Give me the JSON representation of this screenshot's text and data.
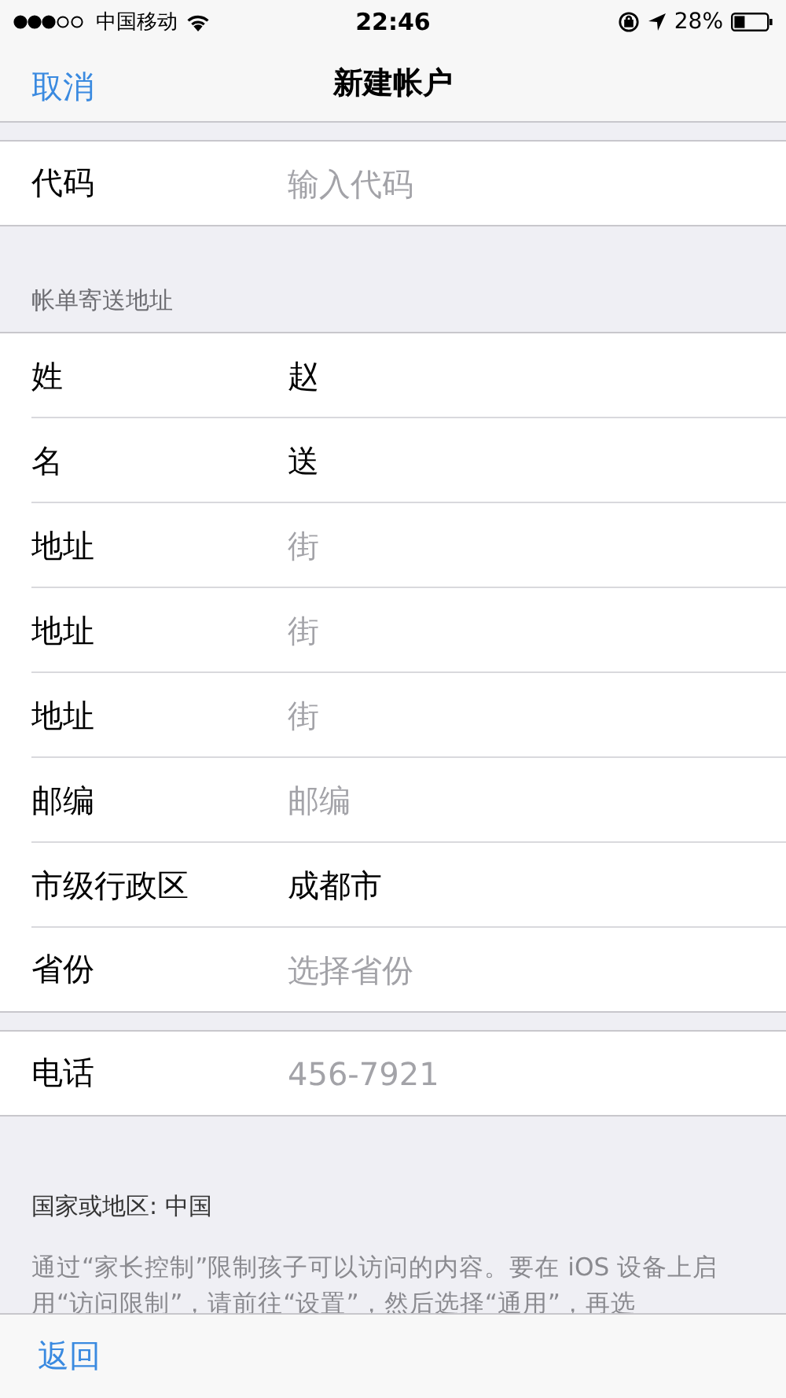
{
  "status_bar": {
    "carrier": "中国移动",
    "time": "22:46",
    "battery": "28%"
  },
  "nav": {
    "cancel": "取消",
    "title": "新建帐户"
  },
  "sections": [
    {
      "rows": [
        {
          "label": "代码",
          "placeholder": "输入代码"
        }
      ]
    },
    {
      "header": "帐单寄送地址",
      "rows": [
        {
          "label": "姓",
          "value": "赵"
        },
        {
          "label": "名",
          "value": "送"
        },
        {
          "label": "地址",
          "placeholder": "街"
        },
        {
          "label": "地址",
          "placeholder": "街"
        },
        {
          "label": "地址",
          "placeholder": "街"
        },
        {
          "label": "邮编",
          "placeholder": "邮编"
        },
        {
          "label": "市级行政区",
          "value": "成都市"
        },
        {
          "label": "省份",
          "placeholder": "选择省份"
        }
      ]
    },
    {
      "rows": [
        {
          "label": "电话",
          "placeholder": "456-7921"
        }
      ]
    }
  ],
  "footer": {
    "country": "国家或地区: 中国",
    "note": "通过“家长控制”限制孩子可以访问的内容。要在 iOS 设备上启用“访问限制”，请前往“设置”，然后选择“通用”，再选"
  },
  "toolbar": {
    "back": "返回"
  }
}
